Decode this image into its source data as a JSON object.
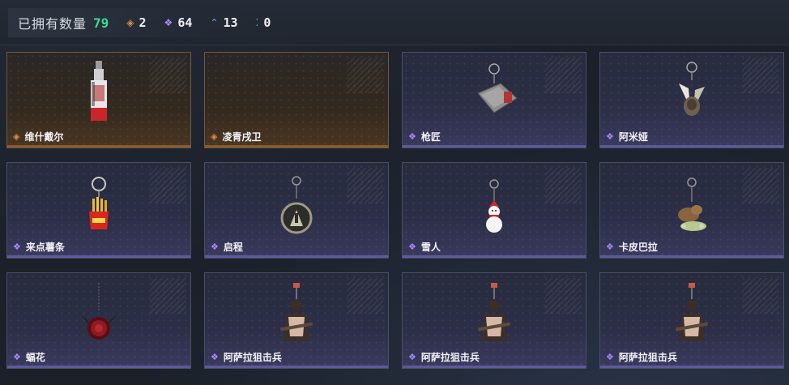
{
  "header": {
    "owned_label": "已拥有数量",
    "owned_count": "79",
    "stats": [
      {
        "icon": "orange-diamond-icon",
        "value": "2"
      },
      {
        "icon": "purple-diamond-icon",
        "value": "64"
      },
      {
        "icon": "blue-chevron-icon",
        "value": "13"
      },
      {
        "icon": "teal-dots-icon",
        "value": "0"
      }
    ]
  },
  "items": [
    {
      "name": "维什戴尔",
      "rarity": "orange",
      "charm": "red-white-tag-charm"
    },
    {
      "name": "凌青戌卫",
      "rarity": "orange",
      "charm": "none"
    },
    {
      "name": "枪匠",
      "rarity": "purple",
      "charm": "metal-plate-charm"
    },
    {
      "name": "阿米娅",
      "rarity": "purple",
      "charm": "rabbit-ears-charm"
    },
    {
      "name": "来点薯条",
      "rarity": "purple",
      "charm": "fries-charm"
    },
    {
      "name": "启程",
      "rarity": "purple",
      "charm": "medal-charm"
    },
    {
      "name": "雪人",
      "rarity": "purple",
      "charm": "snowman-charm"
    },
    {
      "name": "卡皮巴拉",
      "rarity": "purple",
      "charm": "capybara-charm"
    },
    {
      "name": "蝠花",
      "rarity": "purple",
      "charm": "rose-charm"
    },
    {
      "name": "阿萨拉狙击兵",
      "rarity": "purple",
      "charm": "sniper-figure-charm"
    },
    {
      "name": "阿萨拉狙击兵",
      "rarity": "purple",
      "charm": "sniper-figure-charm"
    },
    {
      "name": "阿萨拉狙击兵",
      "rarity": "purple",
      "charm": "sniper-figure-charm"
    }
  ],
  "colors": {
    "owned_count": "#37e08e",
    "orange_rarity": "#e48a46",
    "purple_rarity": "#a98bff",
    "blue_rarity": "#6aa8e8",
    "teal_rarity": "#3ad0b0"
  }
}
